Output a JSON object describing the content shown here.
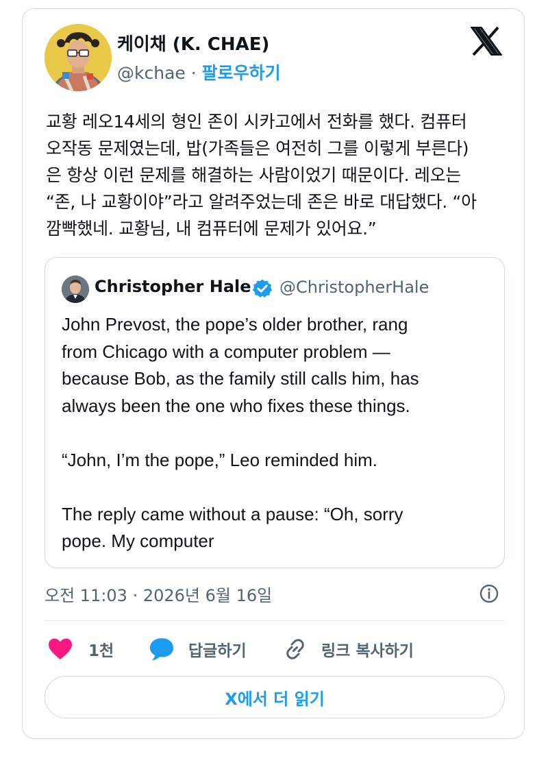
{
  "author": {
    "name": "케이채 (K. CHAE)",
    "handle": "@kchae",
    "separator": "·",
    "follow_label": "팔로우하기"
  },
  "tweet": {
    "lines": [
      "교황 레오14세의 형인 존이 시카고에서 전화를 했다. 컴퓨터",
      "오작동 문제였는데, 밥(가족들은 여전히 그를 이렇게 부른다)",
      "은 항상 이런 문제를 해결하는 사람이었기 때문이다. 레오는",
      "“존, 나 교황이야”라고 알려주었는데 존은 바로 대답했다. “아",
      "깜빡했네. 교황님, 내 컴퓨터에 문제가 있어요.”"
    ]
  },
  "quote": {
    "name": "Christopher Hale",
    "handle": "@ChristopherHale",
    "verified": true,
    "lines": [
      "John Prevost, the pope’s older brother, rang",
      "from Chicago with a computer problem —",
      "because Bob, as the family still calls him, has",
      "always been the one who fixes these things.",
      "",
      "“John, I’m the pope,” Leo reminded him.",
      "",
      "The reply came without a pause: “Oh, sorry",
      "pope. My computer"
    ]
  },
  "meta": {
    "timestamp": "오전 11:03 · 2026년 6월 16일"
  },
  "actions": {
    "like_count": "1천",
    "reply_label": "답글하기",
    "copy_link_label": "링크 복사하기"
  },
  "read_more_label": "X에서 더 읽기",
  "colors": {
    "accent": "#1d9bf0",
    "like": "#f91880",
    "text": "#0f1419",
    "muted": "#536471",
    "border": "#cfd9de"
  },
  "icons": {
    "logo": "x-logo-icon",
    "verified": "verified-badge-icon",
    "info": "info-icon",
    "like": "heart-icon",
    "reply": "speech-bubble-icon",
    "link": "link-icon"
  }
}
